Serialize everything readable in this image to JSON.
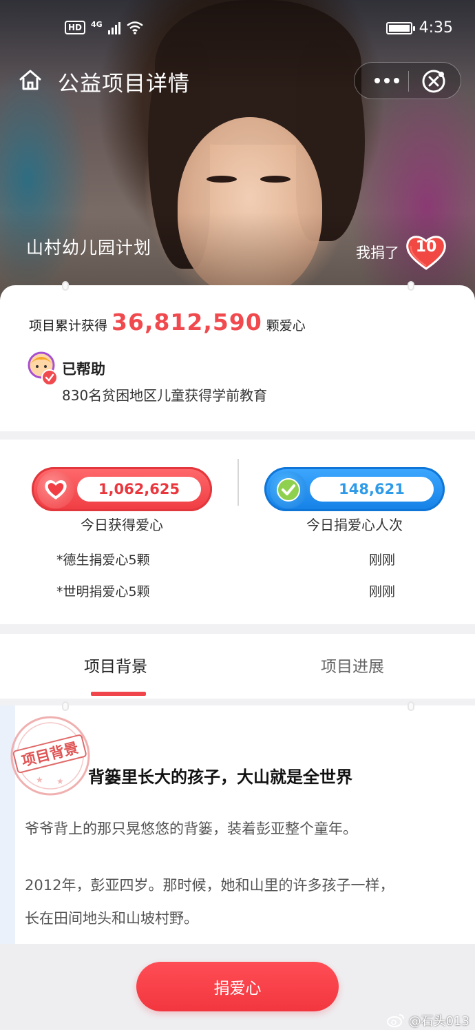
{
  "status_bar": {
    "hd": "HD",
    "network": "4G",
    "time": "4:35"
  },
  "nav": {
    "title": "公益项目详情",
    "icons": [
      "home-icon",
      "more-icon",
      "close-icon"
    ]
  },
  "hero": {
    "project_name": "山村幼儿园计划",
    "donated_label": "我捐了",
    "donated_count": "10"
  },
  "summary": {
    "prefix": "项目累计获得",
    "total": "36,812,590",
    "suffix": "颗爱心",
    "helped_title": "已帮助",
    "helped_desc": "830名贫困地区儿童获得学前教育"
  },
  "today": {
    "hearts_value": "1,062,625",
    "hearts_label": "今日获得爱心",
    "donors_value": "148,621",
    "donors_label": "今日捐爱心人次",
    "feed": [
      {
        "text": "*德生捐爱心5颗",
        "time": "刚刚"
      },
      {
        "text": "*世明捐爱心5颗",
        "time": "刚刚"
      }
    ]
  },
  "tabs": [
    {
      "label": "项目背景",
      "active": true
    },
    {
      "label": "项目进展",
      "active": false
    }
  ],
  "article": {
    "stamp": "项目背景",
    "title": "背篓里长大的孩子，大山就是全世界",
    "paragraphs": [
      "爷爷背上的那只晃悠悠的背篓，装着彭亚整个童年。",
      "2012年，彭亚四岁。那时候，她和山里的许多孩子一样，",
      "长在田间地头和山坡村野。"
    ]
  },
  "bottom": {
    "donate_label": "捐爱心",
    "watermark": "@石头013"
  },
  "colors": {
    "accent_red": "#f04a4f",
    "accent_blue": "#1a86e8"
  }
}
